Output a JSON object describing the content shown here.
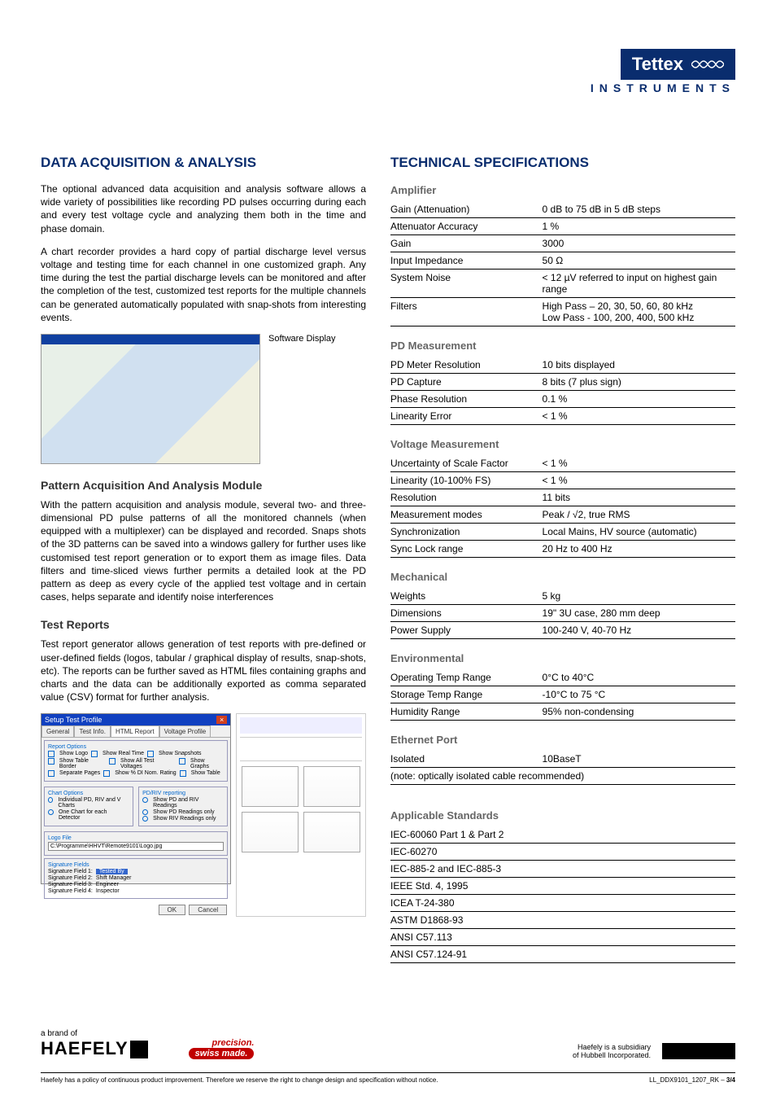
{
  "brand": {
    "tettex": "Tettex",
    "instruments": "INSTRUMENTS",
    "haefely_brand_of": "a brand of",
    "haefely": "HAEFELY",
    "precision": "precision.",
    "swiss": "swiss made.",
    "subsidiary_l1": "Haefely is a subsidiary",
    "subsidiary_l2": "of Hubbell Incorporated."
  },
  "left": {
    "h_data_acq": "DATA ACQUISITION & ANALYSIS",
    "p1": "The optional advanced data acquisition and analysis software allows a wide variety of possibilities like recording PD pulses occurring during each and every test voltage cycle and analyzing them both in the time and phase domain.",
    "p2": "A chart recorder provides a hard copy of partial discharge level versus voltage and testing time for each channel in one customized graph. Any time during the test the partial discharge levels can be monitored and after the completion of the test, customized test reports for the multiple channels can be generated automatically populated with snap-shots from interesting events.",
    "sw_display": "Software Display",
    "h_pattern": "Pattern Acquisition And Analysis Module",
    "p3": "With the pattern acquisition and analysis module, several two- and three-dimensional PD pulse patterns of all the monitored channels (when equipped with a multiplexer) can be displayed and recorded. Snaps shots of the 3D patterns can be saved into a windows gallery for further uses like customised test report generation or to export them as image files. Data filters and time-sliced views further permits a detailed look at the PD pattern as deep as every cycle of the applied test voltage and in certain cases, helps separate and identify noise interferences",
    "h_reports": "Test Reports",
    "p4": "Test report generator allows generation of test reports with pre-defined or user-defined fields (logos, tabular / graphical display of results, snap-shots, etc). The reports can be further saved as HTML files containing graphs and charts and the data can be additionally exported as comma separated value (CSV) format for further analysis.",
    "dialog": {
      "title": "Setup Test Profile",
      "tabs": [
        "General",
        "Test Info.",
        "HTML Report",
        "Voltage Profile"
      ],
      "report_options": "Report Options",
      "ro1": "Show Logo",
      "ro2": "Show Real Time",
      "ro3": "Show Snapshots",
      "ro4": "Show Table Border",
      "ro5": "Show All Test Voltages",
      "ro6": "Show Graphs",
      "ro7": "Separate Pages",
      "ro8": "Show % DI Nom. Rating",
      "ro9": "Show Table",
      "chart_options": "Chart Options",
      "co1": "Individual PD, RIV and V Charts",
      "co2": "One Chart for each Detector",
      "pdriv": "PD/RIV reporting",
      "pr1": "Show PD and RIV Readings",
      "pr2": "Show PD Readings only",
      "pr3": "Show RIV Readings only",
      "logo_file": "Logo File",
      "logo_path": "C:\\Programme\\HHVT\\Remote9101\\Logo.jpg",
      "sig_fields": "Signature Fields",
      "sf1": "Signature Field 1:",
      "sv1": "Tested By",
      "sf2": "Signature Field 2:",
      "sv2": "Shift Manager",
      "sf3": "Signature Field 3:",
      "sv3": "Engineer",
      "sf4": "Signature Field 4:",
      "sv4": "Inspector",
      "ok": "OK",
      "cancel": "Cancel"
    }
  },
  "right": {
    "h_tech": "TECHNICAL SPECIFICATIONS",
    "amplifier": {
      "title": "Amplifier",
      "rows": [
        [
          "Gain (Attenuation)",
          "0 dB to 75 dB in 5 dB steps"
        ],
        [
          "Attenuator Accuracy",
          "1 %"
        ],
        [
          "Gain",
          "3000"
        ],
        [
          "Input Impedance",
          "50 Ω"
        ],
        [
          "System Noise",
          "< 12 µV referred to input on highest gain range"
        ],
        [
          "Filters",
          "High Pass – 20, 30, 50,  60, 80 kHz\nLow Pass - 100, 200, 400, 500 kHz"
        ]
      ]
    },
    "pd_meas": {
      "title": "PD Measurement",
      "rows": [
        [
          "PD Meter Resolution",
          "10 bits displayed"
        ],
        [
          "PD Capture",
          "8 bits (7 plus sign)"
        ],
        [
          "Phase Resolution",
          "0.1 %"
        ],
        [
          "Linearity Error",
          "< 1 %"
        ]
      ]
    },
    "volt_meas": {
      "title": "Voltage Measurement",
      "rows": [
        [
          "Uncertainty of Scale Factor",
          "< 1 %"
        ],
        [
          "Linearity (10-100% FS)",
          "< 1 %"
        ],
        [
          "Resolution",
          "11 bits"
        ],
        [
          "Measurement modes",
          "Peak / √2, true RMS"
        ],
        [
          "Synchronization",
          "Local Mains, HV source (automatic)"
        ],
        [
          "Sync Lock range",
          "20 Hz to 400 Hz"
        ]
      ]
    },
    "mechanical": {
      "title": "Mechanical",
      "rows": [
        [
          "Weights",
          "5 kg"
        ],
        [
          "Dimensions",
          "19\" 3U case, 280 mm deep"
        ],
        [
          "Power Supply",
          "100-240 V, 40-70 Hz"
        ]
      ]
    },
    "environmental": {
      "title": "Environmental",
      "rows": [
        [
          "Operating Temp Range",
          "0°C to 40°C"
        ],
        [
          "Storage Temp Range",
          "-10°C to 75 °C"
        ],
        [
          "Humidity Range",
          "95% non-condensing"
        ]
      ]
    },
    "ethernet": {
      "title": "Ethernet Port",
      "rows": [
        [
          "Isolated",
          "10BaseT"
        ]
      ],
      "note": "(note: optically isolated cable recommended)"
    },
    "standards": {
      "title": "Applicable Standards",
      "rows": [
        "IEC-60060 Part 1 & Part 2",
        "IEC-60270",
        "IEC-885-2 and IEC-885-3",
        "IEEE Std. 4, 1995",
        "ICEA T-24-380",
        "ASTM D1868-93",
        "ANSI C57.113",
        "ANSI C57.124-91"
      ]
    }
  },
  "footer": {
    "policy": "Haefely has a policy of continuous product improvement. Therefore we reserve the right to change design and specification without notice.",
    "doc": "LL_DDX9101_1207_RK – ",
    "page": "3/4"
  }
}
